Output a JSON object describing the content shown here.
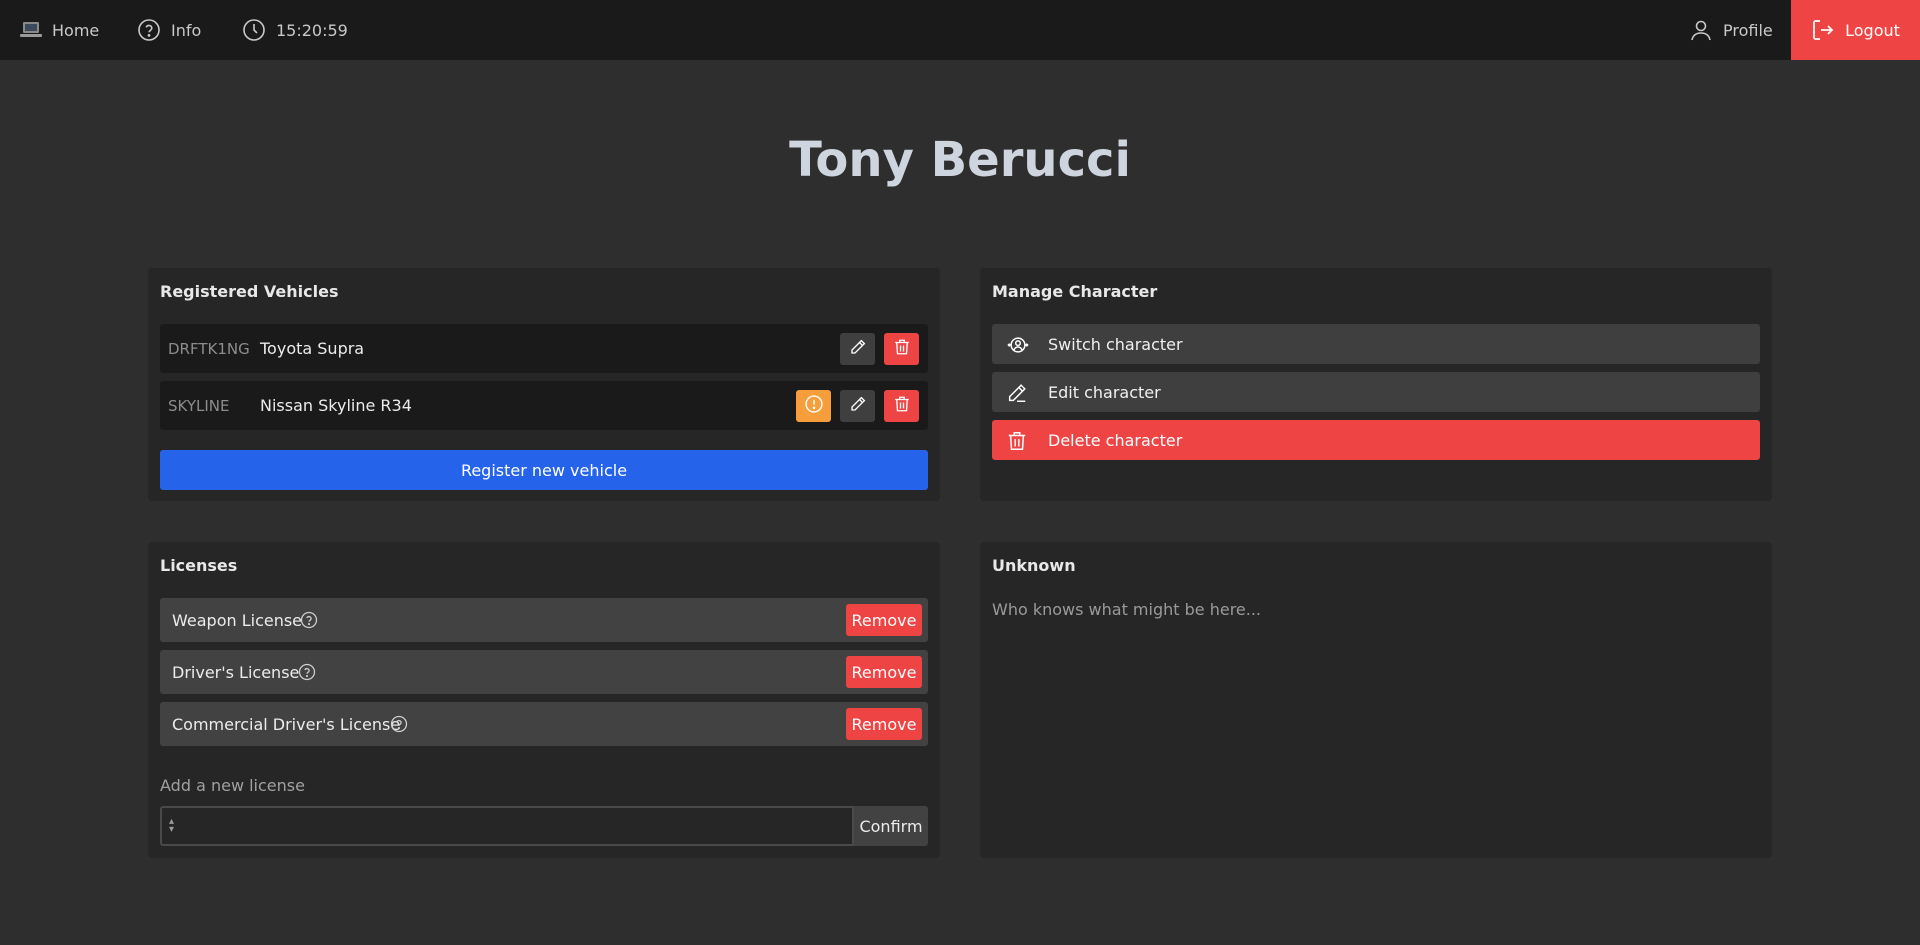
{
  "nav": {
    "home": {
      "label": "Home",
      "icon": "laptop-icon"
    },
    "info": {
      "label": "Info",
      "icon": "question-circle-icon"
    },
    "clock": {
      "label": "15:20:59",
      "icon": "clock-icon"
    },
    "profile": {
      "label": "Profile",
      "icon": "user-icon"
    },
    "logout": {
      "label": "Logout",
      "icon": "logout-icon"
    }
  },
  "page": {
    "title": "Tony Berucci"
  },
  "vehicles": {
    "title": "Registered Vehicles",
    "items": [
      {
        "plate": "DRFTK1NG",
        "name": "Toyota Supra",
        "warning": false
      },
      {
        "plate": "SKYLINE",
        "name": "Nissan Skyline R34",
        "warning": true
      }
    ],
    "register_label": "Register new vehicle"
  },
  "manage": {
    "title": "Manage Character",
    "switch_label": "Switch character",
    "edit_label": "Edit character",
    "delete_label": "Delete character"
  },
  "licenses": {
    "title": "Licenses",
    "items": [
      {
        "name": "Weapon License",
        "remove_label": "Remove"
      },
      {
        "name": "Driver's License",
        "remove_label": "Remove"
      },
      {
        "name": "Commercial Driver's License",
        "remove_label": "Remove"
      }
    ],
    "add_label": "Add a new license",
    "select_value": "",
    "confirm_label": "Confirm"
  },
  "unknown": {
    "title": "Unknown",
    "text": "Who knows what might be here..."
  },
  "colors": {
    "background": "#2e2e2e",
    "topbar": "#1a1a1a",
    "card": "#262626",
    "danger": "#ef4444",
    "primary": "#2563eb",
    "warning": "#f59e3b"
  }
}
